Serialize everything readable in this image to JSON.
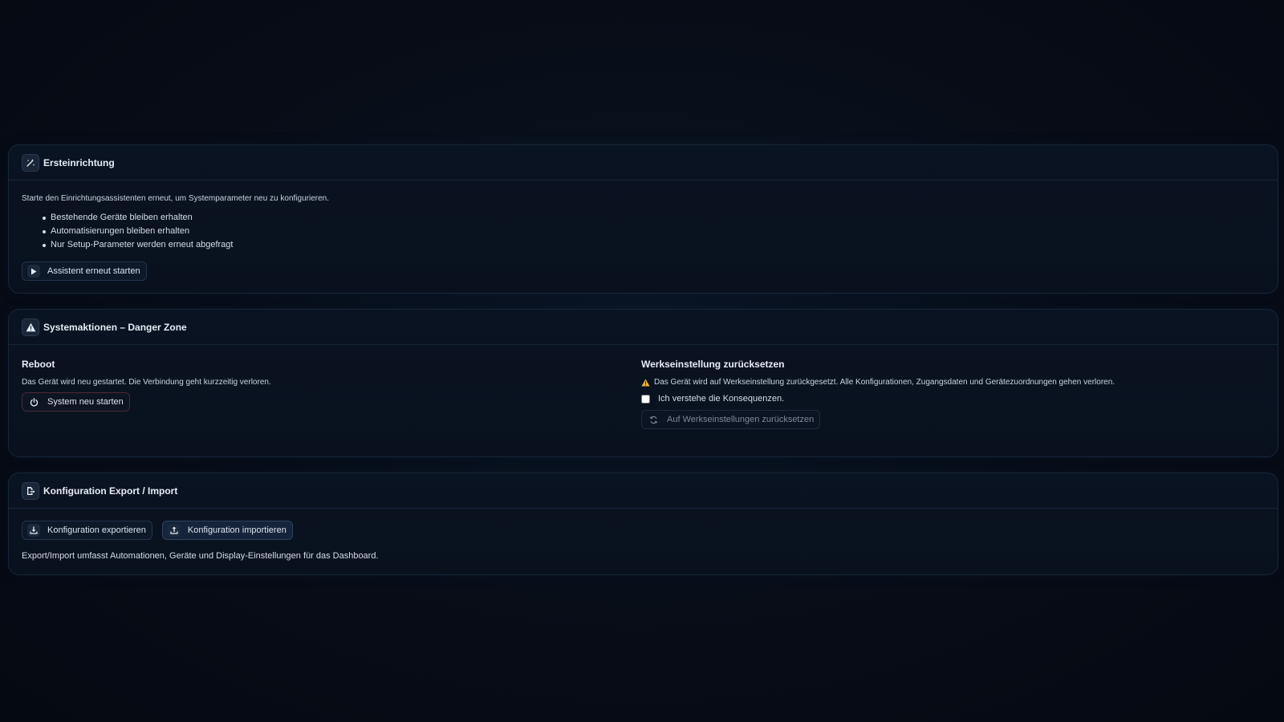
{
  "setup": {
    "title": "Ersteinrichtung",
    "icon": "magic-wand-icon",
    "description": "Starte den Einrichtungsassistenten erneut, um Systemparameter neu zu konfigurieren.",
    "points": [
      "Bestehende Geräte bleiben erhalten",
      "Automatisierungen bleiben erhalten",
      "Nur Setup-Parameter werden erneut abgefragt"
    ],
    "button_label": "Assistent erneut starten",
    "button_icon": "play-icon"
  },
  "danger": {
    "title": "Systemaktionen – Danger Zone",
    "icon": "warning-icon",
    "reboot": {
      "title": "Reboot",
      "description": "Das Gerät wird neu gestartet. Die Verbindung geht kurzzeitig verloren.",
      "button_label": "System neu starten",
      "button_icon": "power-icon"
    },
    "reset": {
      "title": "Werkseinstellung zurücksetzen",
      "warning": "Das Gerät wird auf Werkseinstellung zurückgesetzt. Alle Konfigurationen, Zugangsdaten und Gerätezuordnungen gehen verloren.",
      "checkbox_label": "Ich verstehe die Konsequenzen.",
      "checkbox_checked": false,
      "button_label": "Auf Werkseinstellungen zurücksetzen",
      "button_icon": "refresh-icon",
      "button_disabled": true
    }
  },
  "config": {
    "title": "Konfiguration Export / Import",
    "icon": "file-export-icon",
    "export_label": "Konfiguration exportieren",
    "import_label": "Konfiguration importieren",
    "note": "Export/Import umfasst Automationen, Geräte und Display-Einstellungen für das Dashboard."
  },
  "colors": {
    "background": "#060b14",
    "card": "#0a1322",
    "danger_border": "#4a2a36",
    "warning": "#e8b23a",
    "power_icon": "#e06a7a"
  }
}
